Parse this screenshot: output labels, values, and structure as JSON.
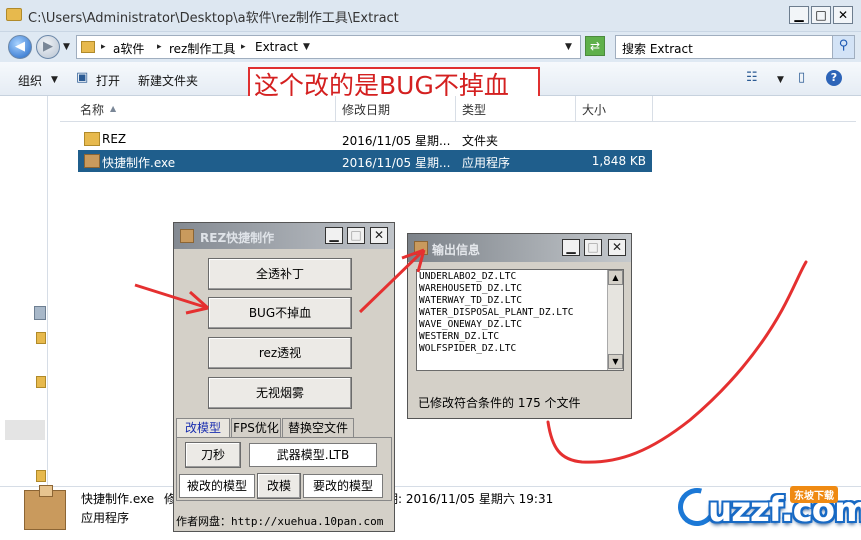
{
  "window": {
    "title": "C:\\Users\\Administrator\\Desktop\\a软件\\rez制作工具\\Extract",
    "min_label": "▁",
    "max_label": "□",
    "close_label": "✕"
  },
  "address": {
    "crumbs": [
      "a软件",
      "rez制作工具",
      "Extract"
    ],
    "search_placeholder": "搜索 Extract"
  },
  "toolbar": {
    "organize": "组织",
    "open": "打开",
    "new_folder": "新建文件夹"
  },
  "annotation": "这个改的是BUG不掉血",
  "columns": {
    "name": "名称",
    "date": "修改日期",
    "type": "类型",
    "size": "大小"
  },
  "files": [
    {
      "name": "REZ",
      "date": "2016/11/05 星期...",
      "type": "文件夹",
      "size": ""
    },
    {
      "name": "快捷制作.exe",
      "date": "2016/11/05 星期...",
      "type": "应用程序",
      "size": "1,848 KB"
    }
  ],
  "details": {
    "name": "快捷制作.exe",
    "prefix": "修",
    "date_info": "期: 2016/11/05 星期六 19:31",
    "kind": "应用程序"
  },
  "rez_dialog": {
    "title": "REZ快捷制作",
    "buttons": [
      "全透补丁",
      "BUG不掉血",
      "rez透视",
      "无视烟雾"
    ],
    "tabs": [
      "改模型",
      "FPS优化",
      "替换空文件"
    ],
    "knife_btn": "刀秒",
    "weapon_box": "武器模型.LTB",
    "target_label": "被改的模型",
    "change_btn": "改模",
    "source_label": "要改的模型",
    "author": "作者网盘：http://xuehua.10pan.com"
  },
  "output_dialog": {
    "title": "输出信息",
    "lines": [
      "UNDERLABO2_DZ.LTC",
      "WAREHOUSETD_DZ.LTC",
      "WATERWAY_TD_DZ.LTC",
      "WATER_DISPOSAL_PLANT_DZ.LTC",
      "WAVE_ONEWAY_DZ.LTC",
      "WESTERN_DZ.LTC",
      "WOLFSPIDER_DZ.LTC"
    ],
    "status": "已修改符合条件的 175 个文件"
  },
  "watermark": {
    "logo": "uzzf.com",
    "tag": "东坡下载"
  },
  "colors": {
    "selection": "#1f5e8c",
    "annotation_red": "#e03030",
    "tab_active": "#1b2fb0"
  }
}
